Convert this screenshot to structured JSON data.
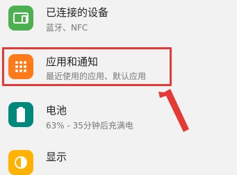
{
  "settings_list": [
    {
      "title": "已连接的设备",
      "subtitle": "蓝牙、NFC",
      "icon": "connected-devices-icon",
      "icon_color": "#4caf50"
    },
    {
      "title": "应用和通知",
      "subtitle": "最近使用的应用、默认应用",
      "icon": "apps-grid-icon",
      "icon_color": "#ff7a1a"
    },
    {
      "title": "电池",
      "subtitle": "63% - 35分钟后充满电",
      "icon": "battery-icon",
      "icon_color": "#00897b"
    },
    {
      "title": "显示",
      "subtitle": "",
      "icon": "display-brightness-icon",
      "icon_color": "#ffb300"
    }
  ],
  "annotation": {
    "highlight_color": "#e53935"
  }
}
